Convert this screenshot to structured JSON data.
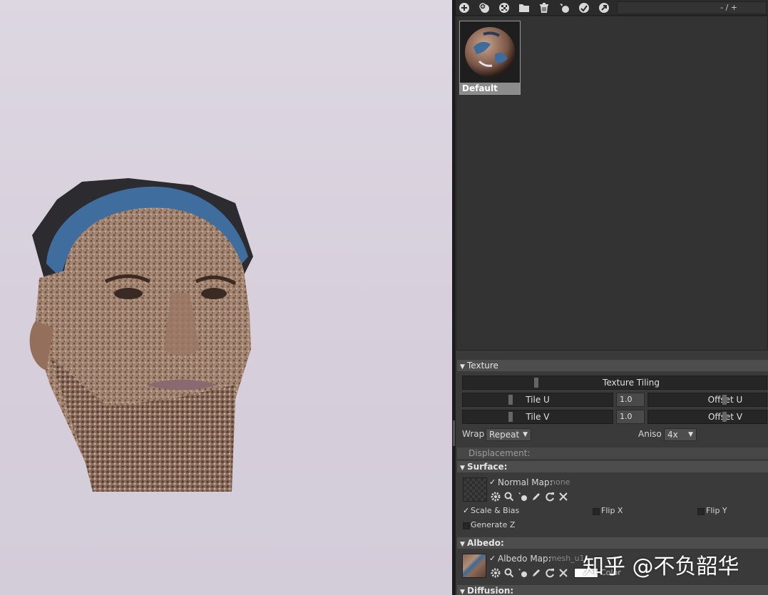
{
  "toolbar": {
    "icons": [
      "add-icon",
      "add-instance-icon",
      "checker-icon",
      "folder-icon",
      "trash-icon",
      "pick-icon",
      "apply-icon",
      "export-icon"
    ],
    "range_text": "- / +"
  },
  "materials": [
    {
      "name": "Default",
      "selected": true
    }
  ],
  "texture": {
    "header": "Texture",
    "tiling_label": "Texture Tiling",
    "tile_u_label": "Tile U",
    "tile_u_value": "1.0",
    "offset_u_label": "Offset U",
    "tile_v_label": "Tile V",
    "tile_v_value": "1.0",
    "offset_v_label": "Offset V",
    "wrap_label": "Wrap",
    "wrap_value": "Repeat",
    "aniso_label": "Aniso",
    "aniso_value": "4x"
  },
  "displacement": {
    "header": "Displacement:"
  },
  "surface": {
    "header": "Surface:",
    "normal_map_label": "Normal Map:",
    "normal_map_value": "none",
    "scale_bias_label": "Scale & Bias",
    "flip_x_label": "Flip X",
    "flip_y_label": "Flip Y",
    "generate_z_label": "Generate Z"
  },
  "albedo": {
    "header": "Albedo:",
    "albedo_map_label": "Albedo Map:",
    "albedo_map_value": "mesh_u1",
    "color_label": "Color",
    "color_value": "#ffffff"
  },
  "diffusion": {
    "header": "Diffusion:"
  },
  "watermark": "知乎 @不负韶华"
}
